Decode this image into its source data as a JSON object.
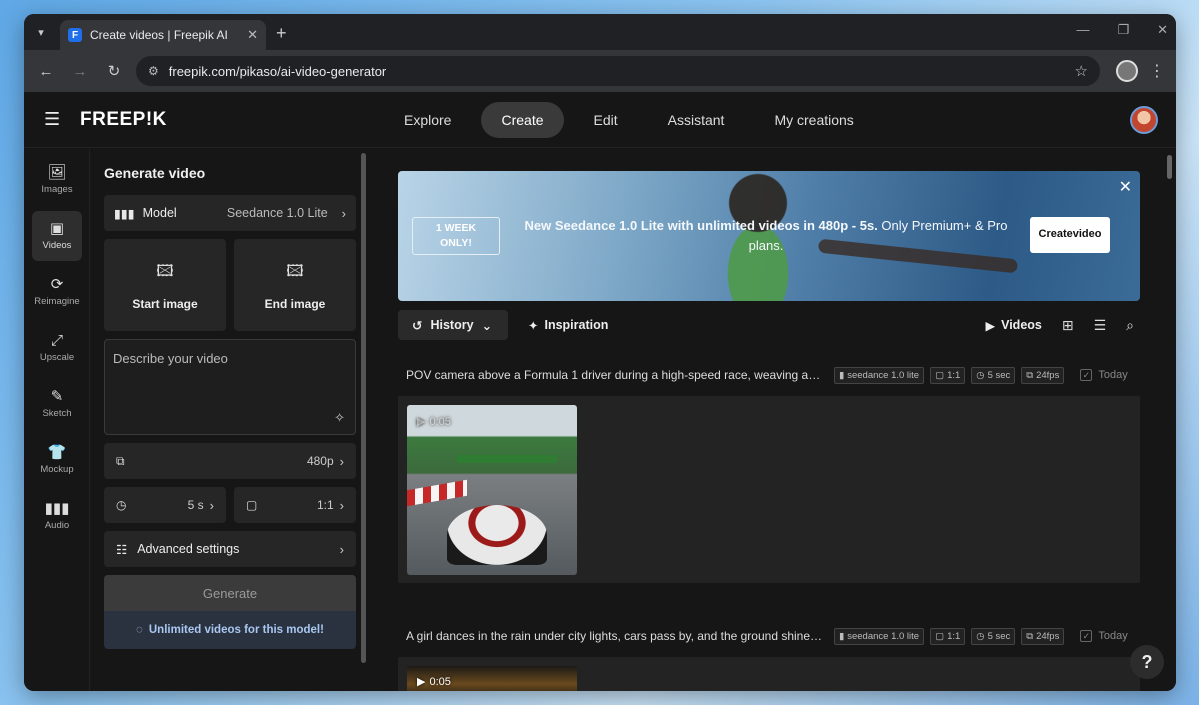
{
  "browser": {
    "tab_title": "Create videos | Freepik AI",
    "favicon_letter": "F",
    "url": "freepik.com/pikaso/ai-video-generator"
  },
  "header": {
    "logo": "FREEP!K",
    "nav": [
      {
        "label": "Explore"
      },
      {
        "label": "Create",
        "active": true
      },
      {
        "label": "Edit"
      },
      {
        "label": "Assistant"
      },
      {
        "label": "My creations"
      }
    ]
  },
  "rail": [
    {
      "label": "Images",
      "icon": "images-icon"
    },
    {
      "label": "Videos",
      "icon": "videos-icon",
      "active": true
    },
    {
      "label": "Reimagine",
      "icon": "reimagine-icon"
    },
    {
      "label": "Upscale",
      "icon": "upscale-icon"
    },
    {
      "label": "Sketch",
      "icon": "sketch-icon"
    },
    {
      "label": "Mockup",
      "icon": "mockup-icon"
    },
    {
      "label": "Audio",
      "icon": "audio-icon"
    }
  ],
  "panel": {
    "title": "Generate video",
    "model_label": "Model",
    "model_value": "Seedance 1.0 Lite",
    "start_image": "Start image",
    "end_image": "End image",
    "prompt_placeholder": "Describe your video",
    "resolution": "480p",
    "duration": "5 s",
    "aspect": "1:1",
    "advanced": "Advanced settings",
    "generate": "Generate",
    "unlimited": "Unlimited videos for this model!"
  },
  "banner": {
    "badge_line1": "1 WEEK",
    "badge_line2": "ONLY!",
    "text_bold": "New Seedance 1.0 Lite with unlimited videos in 480p - 5s.",
    "text_rest": " Only Premium+ & Pro plans.",
    "cta_line1": "Create",
    "cta_line2": "video"
  },
  "toolbar": {
    "history": "History",
    "inspiration": "Inspiration",
    "videos": "Videos"
  },
  "generations": [
    {
      "prompt": "POV camera above a Formula 1 driver during a high-speed race, weaving acros...",
      "model": "seedance 1.0 lite",
      "aspect": "1:1",
      "duration": "5 sec",
      "fps": "24fps",
      "date": "Today",
      "video_time": "0:05"
    },
    {
      "prompt": "A girl dances in the rain under city lights, cars pass by, and the ground shines ...",
      "model": "seedance 1.0 lite",
      "aspect": "1:1",
      "duration": "5 sec",
      "fps": "24fps",
      "date": "Today",
      "video_time": "0:05"
    }
  ],
  "help_label": "?"
}
